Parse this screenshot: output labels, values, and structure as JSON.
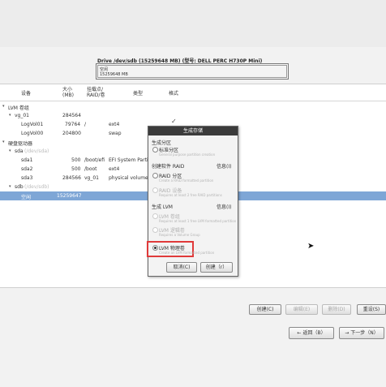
{
  "drive": {
    "title": "Drive /dev/sdb (15259648 MB) (型号: DELL PERC H730P Mini)",
    "free_label": "空闲",
    "free_size": "15259648 MB"
  },
  "table": {
    "headers": {
      "device": "设备",
      "size": "大小\n(MB)",
      "mount": "挂载点/\nRAID/卷",
      "type": "类型",
      "format": "格式"
    },
    "rows": [
      {
        "device": "LVM 卷组",
        "size": "",
        "mount": "",
        "type": ""
      },
      {
        "device": "vg_01",
        "size": "284564",
        "mount": "",
        "type": ""
      },
      {
        "device": "LogVol01",
        "size": "79764",
        "mount": "/",
        "type": "ext4"
      },
      {
        "device": "LogVol00",
        "size": "204800",
        "mount": "",
        "type": "swap"
      },
      {
        "device": "硬盘驱动器",
        "size": "",
        "mount": "",
        "type": ""
      },
      {
        "device": "sda",
        "size": "",
        "mount": "",
        "type": "",
        "suffix": "(/dev/sda)"
      },
      {
        "device": "sda1",
        "size": "500",
        "mount": "/boot/efi",
        "type": "EFI System Partition"
      },
      {
        "device": "sda2",
        "size": "500",
        "mount": "/boot",
        "type": "ext4"
      },
      {
        "device": "sda3",
        "size": "284566",
        "mount": "vg_01",
        "type": "physical volume (LVM)"
      },
      {
        "device": "sdb",
        "size": "",
        "mount": "",
        "type": "",
        "suffix": "(/dev/sdb)"
      },
      {
        "device": "空闲",
        "size": "15259647",
        "mount": "",
        "type": ""
      }
    ]
  },
  "dialog": {
    "title": "生成存储",
    "section_partition": "生成分区",
    "opt_standard": "标准分区",
    "opt_standard_desc": "General purpose partition creation",
    "section_raid": "创建软件 RAID",
    "info_raid": "信息(I)",
    "opt_raid_partition": "RAID 分区",
    "opt_raid_partition_desc": "Create a RAID formatted partition",
    "opt_raid_device": "RAID 设备",
    "opt_raid_device_desc": "Requires at least 2 free RAID partitions",
    "section_lvm": "生成 LVM",
    "info_lvm": "信息(I)",
    "opt_lvm_vg": "LVM 卷组",
    "opt_lvm_vg_desc": "Requires at least 1 free LVM formatted partition",
    "opt_lvm_lv": "LVM 逻辑卷",
    "opt_lvm_lv_desc": "Requires a Volume Group",
    "opt_lvm_pv": "LVM 物理卷",
    "opt_lvm_pv_desc": "Create an LVM formatted partition",
    "cancel": "取消(C)",
    "create": "创建（r）"
  },
  "actions": {
    "create": "创建(C)",
    "edit": "编辑(E)",
    "delete": "删除(D)",
    "reset": "重设(S)"
  },
  "nav": {
    "back": "返回（B）",
    "next": "下一步（N）"
  }
}
